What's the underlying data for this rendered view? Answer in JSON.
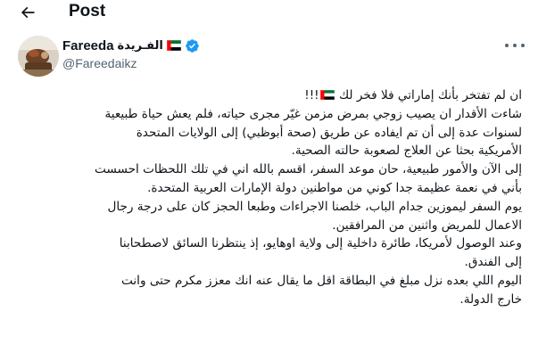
{
  "header": {
    "title": "Post",
    "back_icon": "arrow-left-icon"
  },
  "author": {
    "display_name": "Fareeda",
    "display_name_ar": "الفـريدة",
    "handle": "@Fareedaikz",
    "flag_icon": "uae-flag-icon",
    "verified_icon": "verified-badge-icon",
    "verified_color": "#1d9bf0"
  },
  "more_icon": "more-horizontal-icon",
  "tweet": {
    "line_1_before_flag": "ان لم تفتخر بأنك إماراتي فلا فخر لك",
    "line_1_after_flag": "!!!",
    "lines": [
      "شاءت الأقدار ان يصيب زوجي بمرض مزمن غيّر مجرى حياته، فلم يعش حياة طبيعية",
      "لسنوات عدة إلى أن تم ايفاده عن طريق (صحة أبوظبي) إلى الولايات المتحدة",
      "الأمريكية بحثا عن العلاج لصعوبة حالته الصحية.",
      "إلى الآن والأمور طبيعية، حان موعد السفر، اقسم بالله اني في تلك اللحظات احسست",
      "بأني في نعمة عظيمة جدا كوني من مواطنين دولة الإمارات العربية المتحدة.",
      "يوم السفر ليموزين جدام الباب، خلصنا الاجراءات وطبعا الحجز كان على درجة رجال",
      "الاعمال للمريض واثنين من المرافقين.",
      "وعند الوصول لأمريكا، طائرة داخلية إلى ولاية اوهايو، إذ ينتظرنا السائق لاصطحابنا",
      "إلى الفندق.",
      "اليوم اللي بعده نزل مبلغ في البطاقة اقل ما يقال عنه انك معزز مكرم حتى وانت",
      "خارج الدولة."
    ]
  },
  "colors": {
    "text": "#0f1419",
    "secondary": "#536471",
    "background": "#ffffff"
  }
}
